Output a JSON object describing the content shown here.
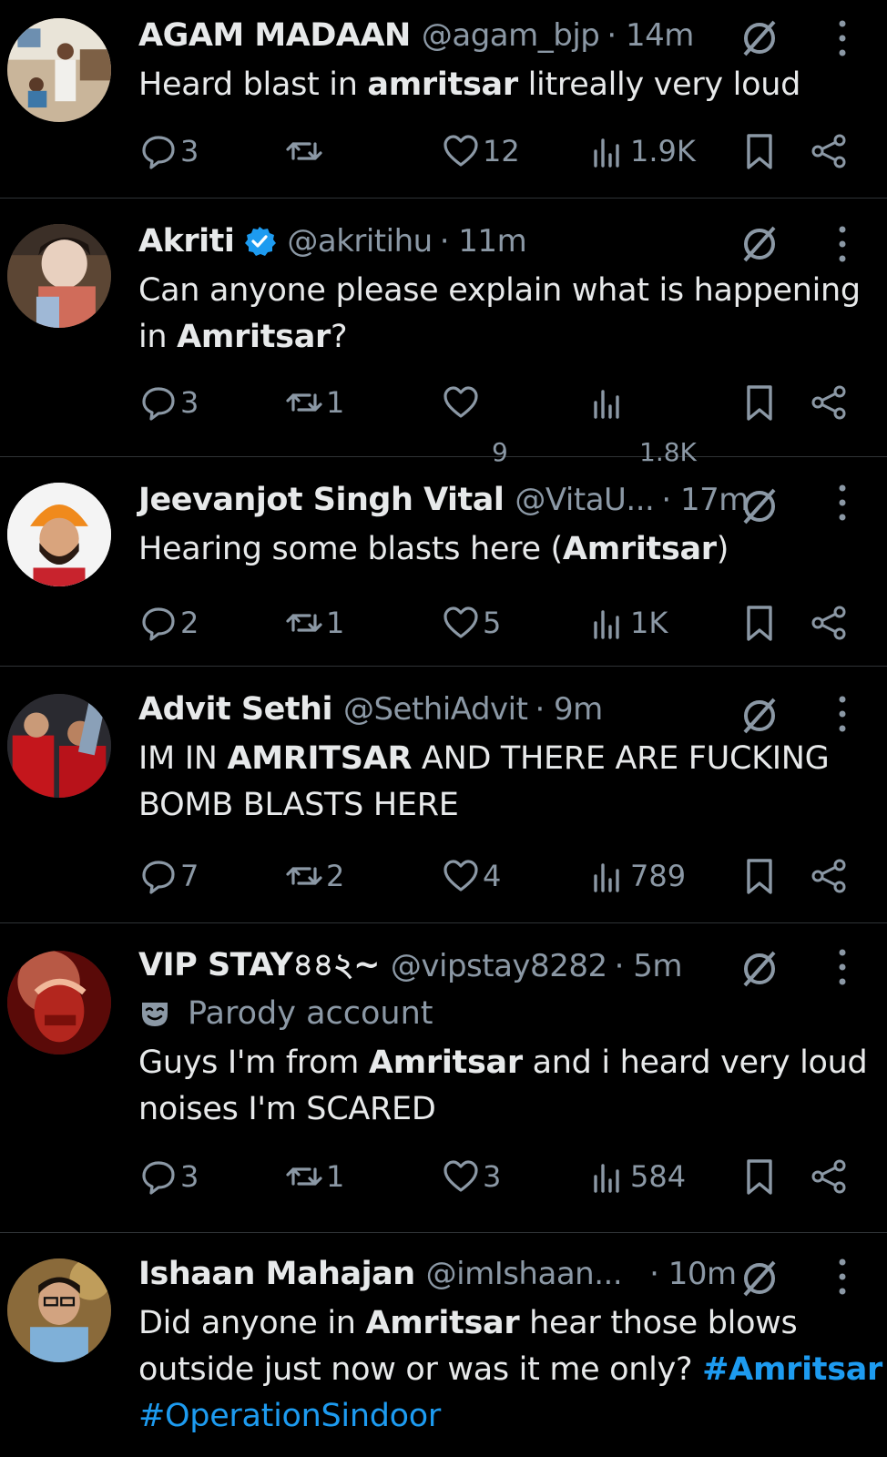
{
  "tweets": [
    {
      "name": "AGAM MADAAN",
      "handle": "@agam_bjp",
      "time": "· 14m",
      "text_parts": [
        "Heard blast in ",
        "amritsar",
        " litreally very loud"
      ],
      "replies": "3",
      "retweets": "",
      "likes": "12",
      "views": "1.9K"
    },
    {
      "name": "Akriti",
      "verified": true,
      "handle": "@akritihu",
      "time": "· 11m",
      "text_parts": [
        "Can anyone please explain what is happening in ",
        "Amritsar",
        "?"
      ],
      "replies": "3",
      "retweets": "1",
      "likes": "9",
      "views": "1.8K"
    },
    {
      "name": "Jeevanjot Singh Vital",
      "handle": "@VitaU...",
      "time": "· 17m",
      "text_parts": [
        "Hearing some blasts here (",
        "Amritsar",
        ")"
      ],
      "replies": "2",
      "retweets": "1",
      "likes": "5",
      "views": "1K"
    },
    {
      "name": "Advit Sethi",
      "handle": "@SethiAdvit",
      "time": "· 9m",
      "text_parts": [
        "IM IN ",
        "AMRITSAR",
        " AND THERE ARE FUCKING BOMB BLASTS HERE"
      ],
      "replies": "7",
      "retweets": "2",
      "likes": "4",
      "views": "789"
    },
    {
      "name": "VIP STAY৪৪২~",
      "handle": "@vipstay8282",
      "time": "· 5m",
      "parody_label": "Parody account",
      "text_parts": [
        "Guys I'm from ",
        "Amritsar",
        " and i heard very loud noises I'm SCARED"
      ],
      "replies": "3",
      "retweets": "1",
      "likes": "3",
      "views": "584"
    },
    {
      "name": "Ishaan Mahajan",
      "handle": "@imIshaan...",
      "time": "· 10m",
      "text_parts": [
        "Did anyone in ",
        "Amritsar",
        " hear those blows outside just now or was it me only? "
      ],
      "hashtags": [
        "#Amritsar",
        "#OperationSindoor"
      ]
    }
  ],
  "icons": {
    "reply": "reply-icon",
    "retweet": "retweet-icon",
    "like": "heart-icon",
    "views": "views-icon",
    "bookmark": "bookmark-icon",
    "share": "share-icon",
    "grok": "grok-icon",
    "more": "more-icon"
  },
  "colors": {
    "background": "#000000",
    "text": "#e7e9ea",
    "muted": "#8b98a5",
    "link": "#1d9bf0",
    "verified": "#1d9bf0"
  }
}
